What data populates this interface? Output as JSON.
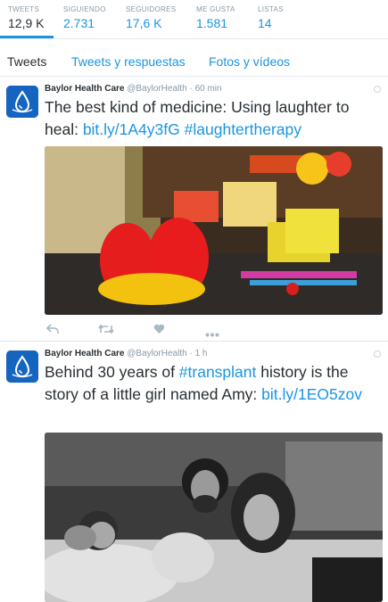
{
  "profile_stats": [
    {
      "label": "TWEETS",
      "value": "12,9 K"
    },
    {
      "label": "SIGUIENDO",
      "value": "2.731"
    },
    {
      "label": "SEGUIDORES",
      "value": "17,6 K"
    },
    {
      "label": "ME GUSTA",
      "value": "1.581"
    },
    {
      "label": "LISTAS",
      "value": "14"
    }
  ],
  "tabs": [
    "Tweets",
    "Tweets y respuestas",
    "Fotos y vídeos"
  ],
  "tweets": [
    {
      "author": "Baylor Health Care",
      "handle": "@BaylorHealth",
      "dot": "·",
      "time": "60 min",
      "text_plain": "The best kind of medicine: Using laughter to heal: ",
      "link": "bit.ly/1A4y3fG",
      "hashtag": "#laughtertherapy"
    },
    {
      "author": "Baylor Health Care",
      "handle": "@BaylorHealth",
      "dot": "·",
      "time": "1 h",
      "text_pre": "Behind 30 years of ",
      "hashtag": "#transplant",
      "text_post": " history is the story of a little girl named Amy: ",
      "link": "bit.ly/1EO5zov"
    }
  ],
  "icons": {
    "reply": "reply-icon",
    "retweet": "retweet-icon",
    "like": "heart-icon",
    "more": "more-icon",
    "avatar": "water-drop-logo"
  },
  "colors": {
    "accent": "#1b95e0",
    "text": "#292f33",
    "muted": "#8899a6",
    "avatar": "#1565c0"
  }
}
